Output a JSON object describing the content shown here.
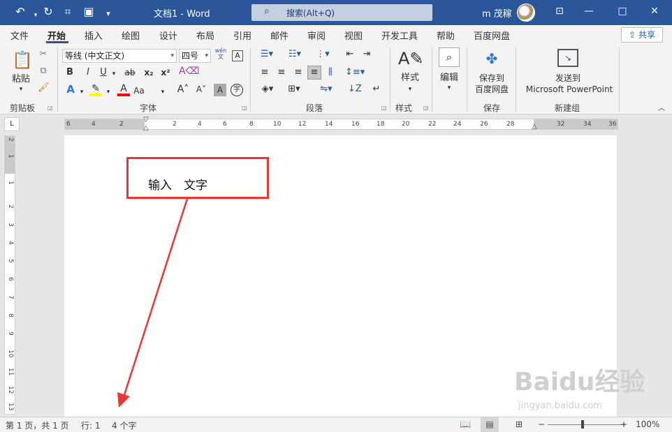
{
  "titlebar": {
    "undo_icon": "undo-icon",
    "redo_icon": "redo-icon",
    "doc_title": "文档1 - Word",
    "search_placeholder": "搜索(Alt+Q)",
    "user_name": "m 茂稼",
    "minimize": "—",
    "maximize": "□",
    "close": "✕"
  },
  "tabs": [
    "文件",
    "开始",
    "插入",
    "绘图",
    "设计",
    "布局",
    "引用",
    "邮件",
    "审阅",
    "视图",
    "开发工具",
    "帮助",
    "百度网盘"
  ],
  "share_label": "共享",
  "ribbon": {
    "clipboard": {
      "paste": "粘贴",
      "group": "剪贴板"
    },
    "font": {
      "name": "等线 (中文正文)",
      "size": "四号",
      "group": "字体",
      "wen_top": "wén",
      "wen_bottom": "文",
      "bold": "B",
      "italic": "I",
      "underline": "U",
      "strike": "ab",
      "sub": "x₂",
      "sup": "x²",
      "font_a": "A",
      "big_a": "A˄",
      "small_a": "A˅",
      "aa": "Aa"
    },
    "paragraph": {
      "group": "段落"
    },
    "styles": {
      "label": "样式",
      "group": "样式"
    },
    "editing": {
      "label": "编辑"
    },
    "save": {
      "line1": "保存到",
      "line2": "百度网盘",
      "group": "保存"
    },
    "newgroup": {
      "line1": "发送到",
      "line2": "Microsoft PowerPoint",
      "group": "新建组"
    }
  },
  "ruler_h": [
    "6",
    "4",
    "2",
    "2",
    "4",
    "6",
    "8",
    "10",
    "12",
    "14",
    "16",
    "18",
    "20",
    "22",
    "24",
    "26",
    "28",
    "32",
    "34",
    "36"
  ],
  "ruler_v": [
    "2",
    "1",
    "1",
    "2",
    "3",
    "4",
    "5",
    "6",
    "7",
    "8",
    "9",
    "10",
    "11",
    "12",
    "13"
  ],
  "document": {
    "text": "输入　文字"
  },
  "watermark": {
    "main": "Baidu经验",
    "sub": "jingyan.baidu.com"
  },
  "status": {
    "page": "第 1 页，共 1 页",
    "line": "行: 1",
    "words": "4 个字",
    "zoom": "100%",
    "minus": "−",
    "plus": "+"
  }
}
